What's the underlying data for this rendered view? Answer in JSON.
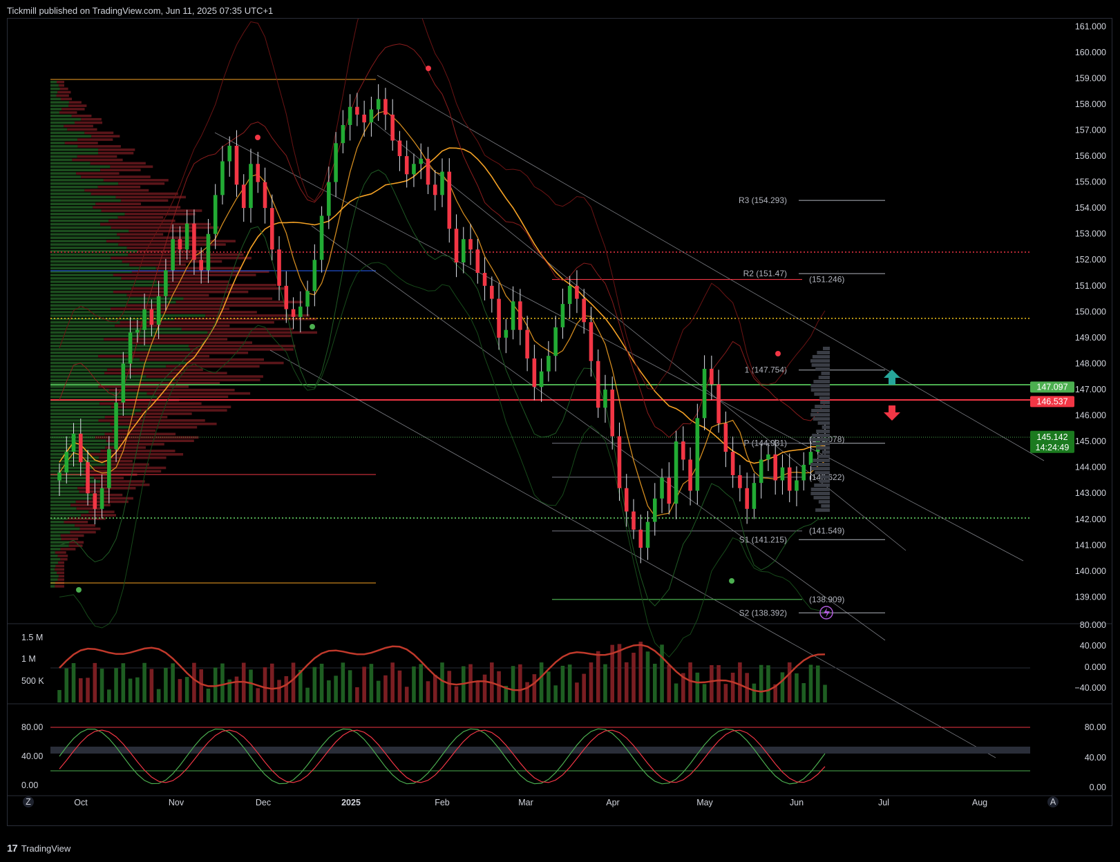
{
  "header": {
    "published": "Tickmill published on TradingView.com, Jun 11, 2025 07:35 UTC+1"
  },
  "footer": {
    "brand_logo": "17",
    "brand_name": "TradingView",
    "z_button": "Z",
    "a_button": "A"
  },
  "colors": {
    "up": "#22ab34",
    "down": "#f23645",
    "orange": "#f7a325",
    "bg": "#000000"
  },
  "chart_data": [
    {
      "type": "candlestick",
      "ylim": [
        138.0,
        161.3
      ],
      "y_ticks": [
        "161.000",
        "160.000",
        "159.000",
        "158.000",
        "157.000",
        "156.000",
        "155.000",
        "154.000",
        "153.000",
        "152.000",
        "151.000",
        "150.000",
        "149.000",
        "148.000",
        "147.000",
        "146.000",
        "145.000",
        "144.000",
        "143.000",
        "142.000",
        "141.000",
        "140.000",
        "139.000"
      ],
      "x_labels": [
        "Oct",
        "Nov",
        "Dec",
        "2025",
        "Feb",
        "Mar",
        "Apr",
        "May",
        "Jun",
        "Jul",
        "Aug"
      ],
      "close_path": [
        143.8,
        144.6,
        145.3,
        144.2,
        143.0,
        142.4,
        143.2,
        144.7,
        146.5,
        148.0,
        149.2,
        149.3,
        150.1,
        149.5,
        150.6,
        151.6,
        152.8,
        152.4,
        153.4,
        152.0,
        151.6,
        153.0,
        154.5,
        155.8,
        156.4,
        154.9,
        154.0,
        155.7,
        155.0,
        154.0,
        152.4,
        151.0,
        150.1,
        149.8,
        150.2,
        150.8,
        152.0,
        153.7,
        155.0,
        156.5,
        157.2,
        157.9,
        157.6,
        157.3,
        157.8,
        158.2,
        157.6,
        156.6,
        156.0,
        155.3,
        155.7,
        155.9,
        154.9,
        154.5,
        155.4,
        153.2,
        151.9,
        152.8,
        152.4,
        151.5,
        151.0,
        150.5,
        149.0,
        149.3,
        150.4,
        149.3,
        148.2,
        147.1,
        147.7,
        148.3,
        149.4,
        150.3,
        151.0,
        150.5,
        149.6,
        148.1,
        146.3,
        147.0,
        145.2,
        143.2,
        142.3,
        141.6,
        140.9,
        141.9,
        142.8,
        143.6,
        142.6,
        145.0,
        144.3,
        143.1,
        145.9,
        147.8,
        147.2,
        145.7,
        144.6,
        143.7,
        143.2,
        142.4,
        143.4,
        144.3,
        144.5,
        143.5,
        144.0,
        143.1,
        143.5,
        144.1,
        144.6,
        145.0,
        145.14
      ],
      "volume_axis": [
        "1.5 M",
        "1 M",
        "500 K"
      ],
      "cci_axis": [
        "80.000",
        "40.000",
        "0.000",
        "−40.000"
      ],
      "stoch_axis": [
        "80.00",
        "40.00",
        "0.00"
      ],
      "stoch_axis_right": [
        "80.00",
        "40.00",
        "0.00"
      ],
      "pivots": [
        {
          "label": "R3 (154.293)",
          "value": 154.293
        },
        {
          "label": "R2 (151.47)",
          "value": 151.47
        },
        {
          "label": "1 (147.754)",
          "value": 147.754
        },
        {
          "label": "P (144.931)",
          "value": 144.931
        },
        {
          "label": "S1 (141.215)",
          "value": 141.215
        },
        {
          "label": "S2 (138.392)",
          "value": 138.392
        }
      ],
      "level_labels": [
        {
          "text": "(151.246)",
          "value": 151.246,
          "color": "#f23645"
        },
        {
          "text": "(145.078)",
          "value": 145.078,
          "color": "#787b86"
        },
        {
          "text": "(143.622)",
          "value": 143.622,
          "color": "#787b86"
        },
        {
          "text": "(141.549)",
          "value": 141.549,
          "color": "#787b86"
        },
        {
          "text": "(138.909)",
          "value": 138.909,
          "color": "#22ab34"
        }
      ],
      "price_tags": [
        {
          "text": "147.097",
          "value": 147.097,
          "color": "#4caf50"
        },
        {
          "text": "146.537",
          "value": 146.537,
          "color": "#f23645"
        }
      ],
      "last_price": {
        "value": 145.142,
        "text": "145.142",
        "countdown": "14:24:49",
        "color": "#089981"
      }
    }
  ]
}
